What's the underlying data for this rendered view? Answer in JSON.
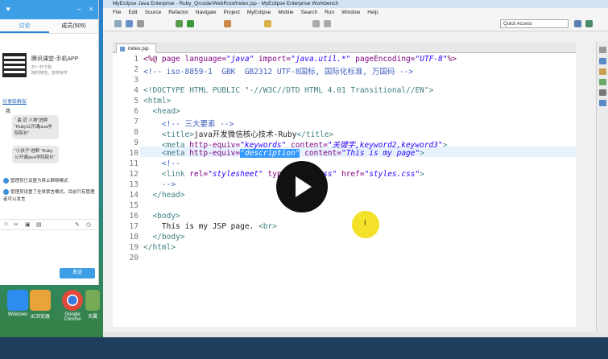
{
  "desktop": {
    "icons": [
      {
        "label": "Windows"
      },
      {
        "label": "IE浏览器"
      },
      {
        "label": "Google Chrome"
      },
      {
        "label": "天翼"
      }
    ]
  },
  "chat": {
    "tabs": [
      "讨论",
      "成员(505)"
    ],
    "ad": {
      "title": "腾讯课堂-手机APP",
      "line1": "扫一扫下载",
      "line2": "随时随地，想学就学"
    },
    "link": "分享给群友",
    "self_label": "我",
    "messages": [
      {
        "text": "“ 最 近 人物”进群 “Ruby公开课java学院院长”"
      },
      {
        "text": "“小孩子”进群 “Ruby公开课java学院院长”"
      }
    ],
    "notices": [
      "管理员已设置为禁止群聊模式",
      "管理员设置了全体禁言模式，目前只有管理者可以发言"
    ],
    "send_label": "发送"
  },
  "eclipse": {
    "title": "MyEclipse Java Enterprise - Ruby_Qrcode/WebRoot/index.jsp - MyEclipse Enterprise Workbench",
    "menu": [
      "File",
      "Edit",
      "Source",
      "Refactor",
      "Navigate",
      "Project",
      "MyEclipse",
      "Mobile",
      "Search",
      "Run",
      "Window",
      "Help"
    ],
    "quick_access": "Quick Access",
    "editor_tab": "index.jsp",
    "line_numbers": [
      "1",
      "2",
      "3",
      "4",
      "5",
      "6",
      "7",
      "8",
      "9",
      "10",
      "11",
      "12",
      "13",
      "14",
      "15",
      "16",
      "17",
      "18",
      "19",
      "20"
    ]
  },
  "code": {
    "l1": [
      "<%@ ",
      "page language=",
      "\"java\"",
      " import=",
      "\"java.util.*\"",
      " pageEncoding=",
      "\"UTF-8\"",
      "%>"
    ],
    "l2": "<!-- iso-8859-1  GBK  GB2312 UTF-8国标, 国际化标准, 万国码 -->",
    "l4": "<!DOCTYPE HTML PUBLIC \"-//W3C//DTD HTML 4.01 Transitional//EN\">",
    "l5": "<html>",
    "l6": "  <head>",
    "l7": "    <!-- 三大要素 -->",
    "l8": [
      "    <title>",
      "java开发微信核心技术-Ruby",
      "</title>"
    ],
    "l9": [
      "    <meta ",
      "http-equiv=",
      "\"keywords\"",
      " content=",
      "\"关键字,keyword2,keyword3\"",
      ">"
    ],
    "l10": [
      "    <meta ",
      "http-equiv=",
      "\"description\"",
      " content=",
      "\"This is my page\"",
      ">"
    ],
    "l11": "    <!--",
    "l12": [
      "    <link ",
      "rel=",
      "\"stylesheet\"",
      " type=",
      "\"text/css\"",
      " href=",
      "\"styles.css\"",
      ">"
    ],
    "l13": "    -->",
    "l14": "  </head>",
    "l16": "  <body>",
    "l17": [
      "    This is my JSP page. ",
      "<br>"
    ],
    "l18": "  </body>",
    "l19": "</html>"
  },
  "overlay": {
    "cursor_glyph": "I"
  }
}
